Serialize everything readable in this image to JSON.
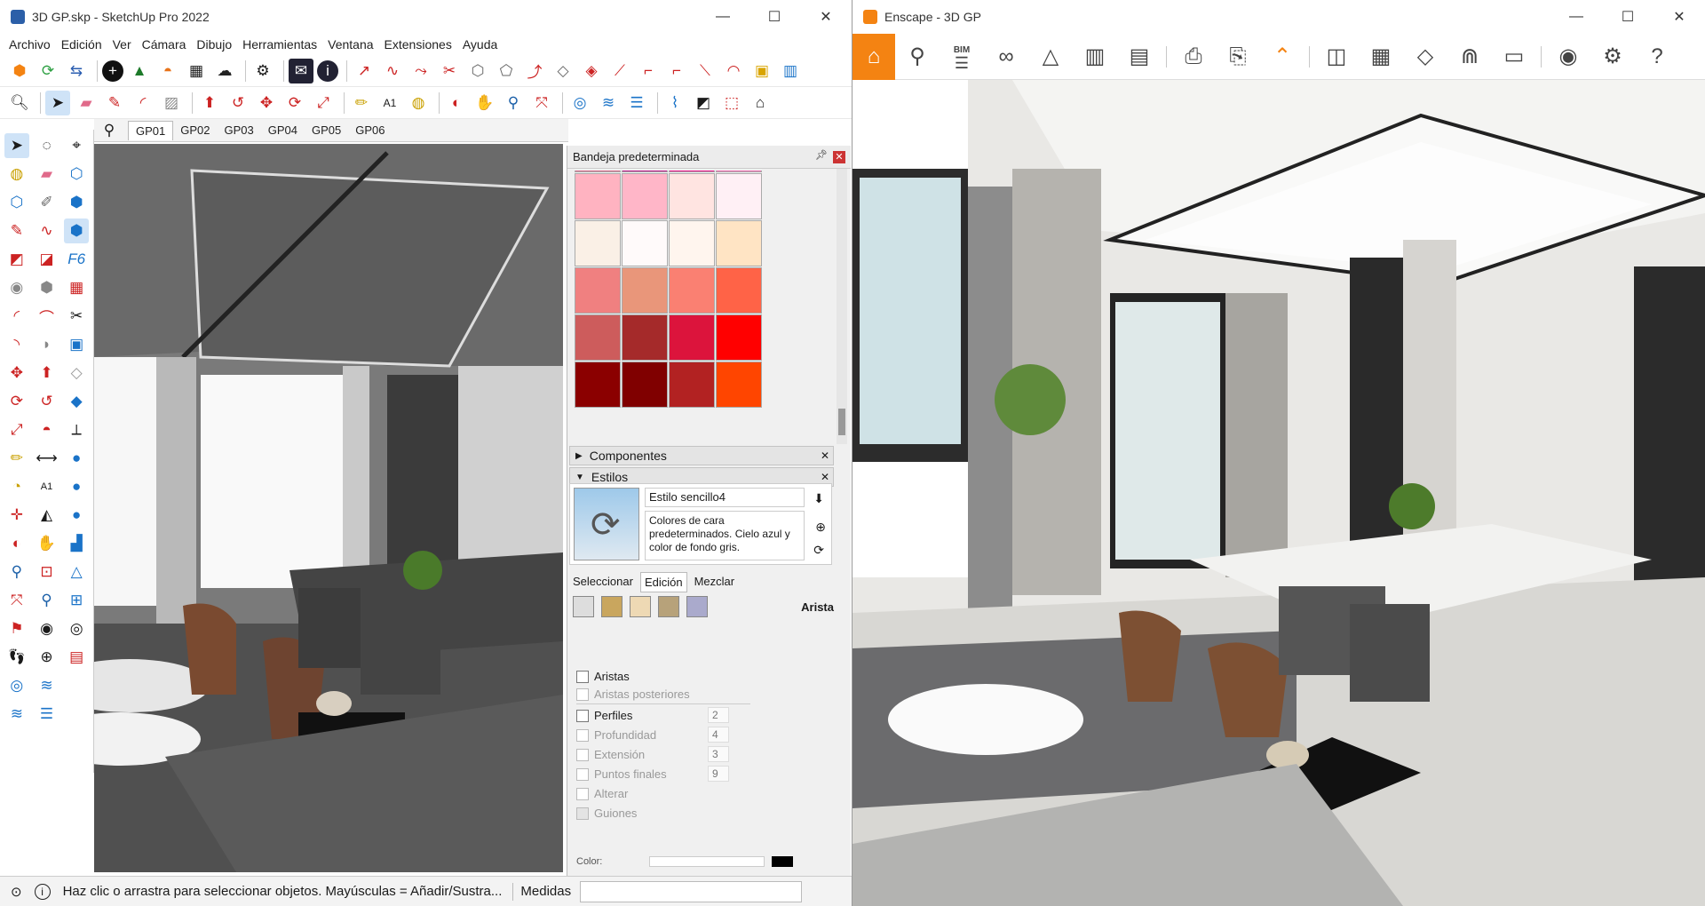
{
  "sketchup": {
    "title": "3D GP.skp - SketchUp Pro 2022",
    "window_controls": [
      "—",
      "☐",
      "✕"
    ],
    "menu": [
      "Archivo",
      "Edición",
      "Ver",
      "Cámara",
      "Dibujo",
      "Herramientas",
      "Ventana",
      "Extensiones",
      "Ayuda"
    ],
    "toolbar_row1": [
      "enscape-logo-icon",
      "enscape-sync-icon",
      "enscape-capture-icon",
      "add-icon",
      "tree-icon",
      "sunrise-icon",
      "checker-icon",
      "cloud-upload-icon",
      "gears-icon",
      "mail-icon",
      "info-icon",
      "tool-icon",
      "tool-icon",
      "tool-icon",
      "tool-icon",
      "tool-icon",
      "tool-icon",
      "tool-icon",
      "tool-icon",
      "tool-icon",
      "tool-icon",
      "tool-icon",
      "tool-icon",
      "tool-icon",
      "package-icon",
      "panel-icon"
    ],
    "toolbar_row2": [
      "zoom-icon",
      "select-arrow-icon",
      "eraser-icon",
      "pencil-icon",
      "arc-icon",
      "rectangle-icon",
      "push-pull-icon",
      "follow-me-icon",
      "move-icon",
      "rotate-icon",
      "scale-icon",
      "tape-icon",
      "text-icon",
      "paint-icon",
      "orbit-icon",
      "pan-icon",
      "zoom-icon",
      "zoom-extents-icon",
      "sandbox-icon",
      "layers-icon",
      "layers2-icon",
      "stairs-icon",
      "eraser2-icon",
      "box-icon",
      "house-icon"
    ],
    "scene_tabs": [
      "GP01",
      "GP02",
      "GP03",
      "GP04",
      "GP05",
      "GP06"
    ],
    "tray": {
      "title": "Bandeja predeterminada",
      "swatch_colors": [
        [
          "#d96a8a",
          "#c0188c",
          "#f0148c",
          "#f36bb0"
        ],
        [
          "#ffb3c1",
          "#ffb6c8",
          "#ffe4e1",
          "#fff0f5"
        ],
        [
          "#faf0e6",
          "#fffafa",
          "#fff5ee",
          "#ffe4c4"
        ],
        [
          "#f08080",
          "#e9967a",
          "#fa8072",
          "#ff6347"
        ],
        [
          "#cd5c5c",
          "#a52a2a",
          "#dc143c",
          "#ff0000"
        ],
        [
          "#8b0000",
          "#800000",
          "#b22222",
          "#ff4500"
        ]
      ],
      "components_label": "Componentes",
      "styles_label": "Estilos",
      "style_name": "Estilo sencillo4",
      "style_desc": "Colores de cara predeterminados. Cielo azul y color de fondo gris.",
      "tabs": [
        "Seleccionar",
        "Edición",
        "Mezclar"
      ],
      "edit_section": "Arista",
      "options": [
        {
          "label": "Aristas",
          "enabled": true,
          "value": ""
        },
        {
          "label": "Aristas posteriores",
          "enabled": false,
          "value": ""
        },
        {
          "label": "Perfiles",
          "enabled": true,
          "value": "2"
        },
        {
          "label": "Profundidad",
          "enabled": false,
          "value": "4"
        },
        {
          "label": "Extensión",
          "enabled": false,
          "value": "3"
        },
        {
          "label": "Puntos finales",
          "enabled": false,
          "value": "9"
        },
        {
          "label": "Alterar",
          "enabled": false,
          "value": ""
        },
        {
          "label": "Guiones",
          "enabled": false,
          "value": ""
        }
      ],
      "color_label": "Color:"
    },
    "status_text": "Haz clic o arrastra para seleccionar objetos. Mayúsculas = Añadir/Sustra...",
    "measures_label": "Medidas"
  },
  "enscape": {
    "title": "Enscape - 3D GP",
    "window_controls": [
      "—",
      "☐",
      "✕"
    ],
    "bim_label": "BIM",
    "toolbar": [
      "home-icon",
      "location-icon",
      "bim-icon",
      "binoculars-icon",
      "sun-icon",
      "buildings-icon",
      "clapper-icon",
      "batch-render-icon",
      "batch-render2-icon",
      "collapse-up-icon",
      "map-icon",
      "panorama-icon",
      "cube-icon",
      "asset-icon",
      "vr-headset-icon",
      "eye-icon",
      "settings-icon",
      "help-icon"
    ]
  },
  "colors": {
    "enscape_orange": "#f48312",
    "sketchup_accent": "#1a73c8"
  }
}
